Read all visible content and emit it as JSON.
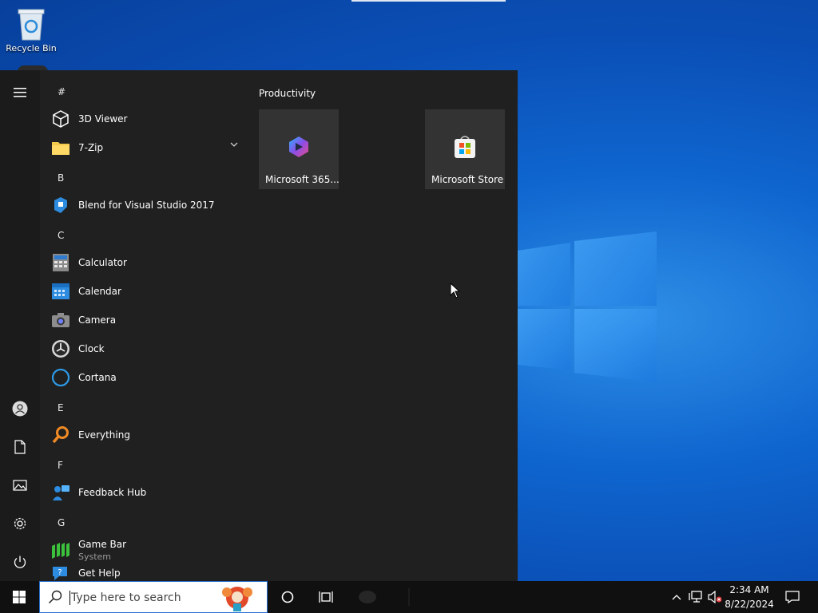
{
  "desktop": {
    "recycle_bin_label": "Recycle Bin"
  },
  "start_menu": {
    "rail": {
      "icons": [
        "hamburger-menu-icon",
        "user-account-icon",
        "documents-icon",
        "pictures-icon",
        "settings-icon",
        "power-icon"
      ]
    },
    "app_list": {
      "sections": [
        {
          "letter": "#",
          "apps": [
            {
              "name": "3D Viewer",
              "icon": "cube-icon"
            },
            {
              "name": "7-Zip",
              "icon": "folder-icon",
              "expandable": true
            }
          ]
        },
        {
          "letter": "B",
          "apps": [
            {
              "name": "Blend for Visual Studio 2017",
              "icon": "blend-icon"
            }
          ]
        },
        {
          "letter": "C",
          "apps": [
            {
              "name": "Calculator",
              "icon": "calculator-icon"
            },
            {
              "name": "Calendar",
              "icon": "calendar-icon"
            },
            {
              "name": "Camera",
              "icon": "camera-icon"
            },
            {
              "name": "Clock",
              "icon": "clock-icon"
            },
            {
              "name": "Cortana",
              "icon": "cortana-icon"
            }
          ]
        },
        {
          "letter": "E",
          "apps": [
            {
              "name": "Everything",
              "icon": "magnifier-icon"
            }
          ]
        },
        {
          "letter": "F",
          "apps": [
            {
              "name": "Feedback Hub",
              "icon": "feedback-hub-icon"
            }
          ]
        },
        {
          "letter": "G",
          "apps": [
            {
              "name": "Game Bar",
              "subtitle": "System",
              "icon": "game-bar-icon"
            },
            {
              "name": "Get Help",
              "icon": "get-help-icon"
            }
          ]
        }
      ]
    },
    "tiles": {
      "group_title": "Productivity",
      "items": [
        {
          "label": "Microsoft 365...",
          "icon": "microsoft-365-icon"
        },
        {
          "label": "Microsoft Store",
          "icon": "microsoft-store-icon"
        }
      ]
    }
  },
  "taskbar": {
    "search": {
      "placeholder": "Type here to search"
    },
    "buttons": [
      "start-windows-icon",
      "cortana-circle-icon",
      "task-view-icon"
    ],
    "tray": {
      "icons": [
        "chevron-up-icon",
        "network-icon",
        "volume-muted-icon"
      ],
      "time": "2:34 AM",
      "date": "8/22/2024"
    }
  },
  "colors": {
    "desktop_blue": "#0a4fb6",
    "start_bg": "#202020",
    "tile_bg": "#333333",
    "taskbar_bg": "#101010"
  }
}
